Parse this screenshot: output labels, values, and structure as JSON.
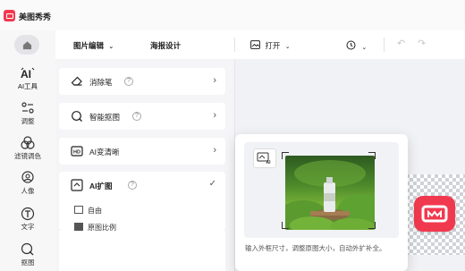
{
  "app": {
    "name": "美图秀秀"
  },
  "toolbar": {
    "tab_edit": "图片编辑",
    "tab_poster": "海报设计",
    "open": "打开"
  },
  "rail": {
    "items": [
      {
        "label": "AI工具",
        "icon": "ai-icon"
      },
      {
        "label": "调整",
        "icon": "adjust-icon"
      },
      {
        "label": "滤镜调色",
        "icon": "filter-icon"
      },
      {
        "label": "人像",
        "icon": "portrait-icon"
      },
      {
        "label": "文字",
        "icon": "text-icon"
      },
      {
        "label": "抠图",
        "icon": "cutout-icon"
      }
    ]
  },
  "panel": {
    "tools": [
      {
        "label": "消除笔",
        "icon": "eraser-icon"
      },
      {
        "label": "智能抠图",
        "icon": "smart-cutout-icon"
      },
      {
        "label": "AI变清晰",
        "icon": "ai-clarify-icon"
      },
      {
        "label": "AI扩图",
        "icon": "ai-expand-icon"
      }
    ],
    "sub_options": [
      "自由",
      "原图比例"
    ]
  },
  "popup": {
    "chip_label": "AI",
    "description": "输入外框尺寸，调整原图大小，自动外扩补全。"
  },
  "colors": {
    "brand": "#f0394f"
  }
}
